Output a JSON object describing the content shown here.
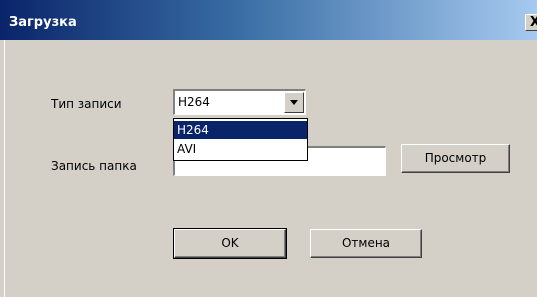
{
  "window": {
    "title": "Загрузка",
    "close_label": "X"
  },
  "form": {
    "record_type_label": "Тип записи",
    "record_type_value": "H264",
    "record_type_options": [
      "H264",
      "AVI"
    ],
    "folder_label": "Запись папка",
    "folder_value": "",
    "browse_label": "Просмотр"
  },
  "buttons": {
    "ok_label": "OK",
    "cancel_label": "Отмена"
  }
}
